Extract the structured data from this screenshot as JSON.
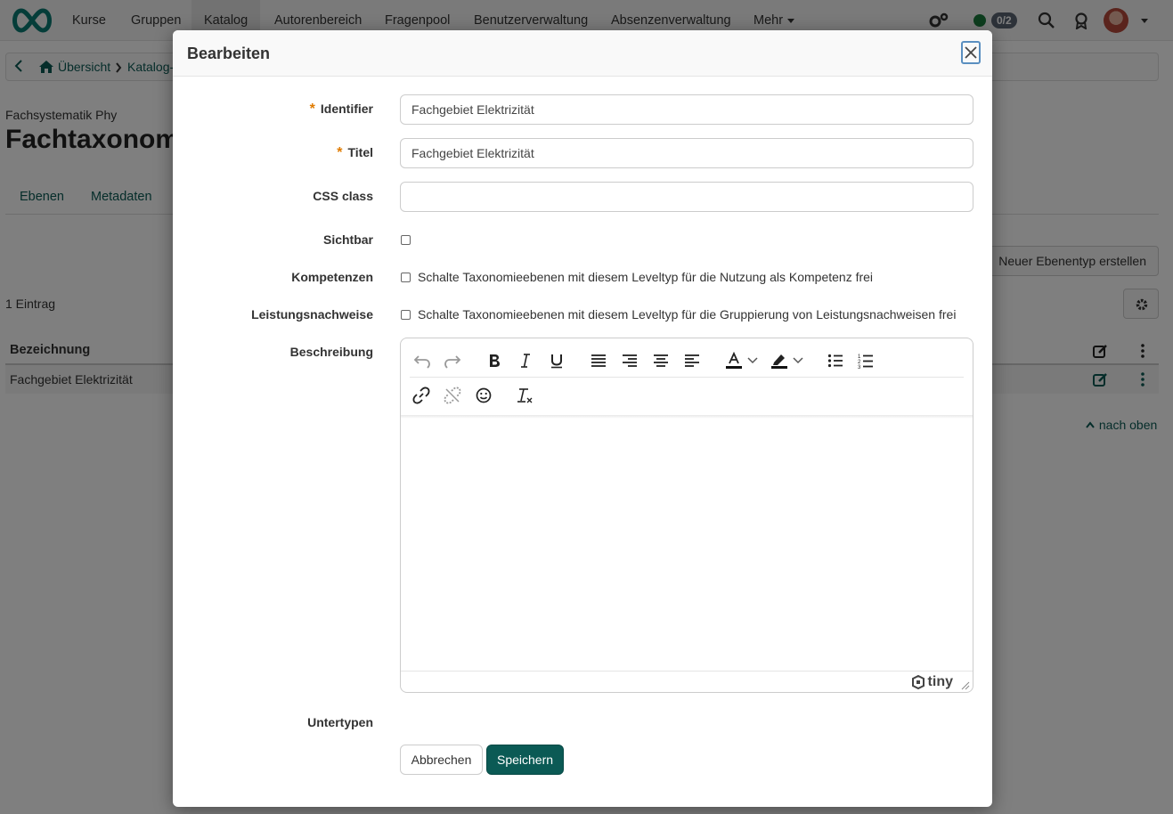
{
  "topnav": {
    "items": [
      "Kurse",
      "Gruppen",
      "Katalog",
      "Autorenbereich",
      "Fragenpool",
      "Benutzerverwaltung",
      "Absenzenverwaltung",
      "Mehr"
    ],
    "active": "Katalog",
    "badge": "0/2"
  },
  "breadcrumb": {
    "items": [
      "Übersicht",
      "Katalog-"
    ]
  },
  "page": {
    "subtitle": "Fachsystematik Phy",
    "title": "Fachtaxonomi",
    "tabs": [
      "Ebenen",
      "Metadaten"
    ],
    "new_type_button": "Neuer Ebenentyp erstellen",
    "count": "1 Eintrag",
    "table_header": "Bezeichnung",
    "table_row": "Fachgebiet Elektrizität",
    "back_to_top": "nach oben"
  },
  "modal": {
    "title": "Bearbeiten",
    "identifier_label": "Identifier",
    "identifier_value": "Fachgebiet Elektrizität",
    "titel_label": "Titel",
    "titel_value": "Fachgebiet Elektrizität",
    "css_label": "CSS class",
    "css_value": "",
    "sichtbar_label": "Sichtbar",
    "kompetenzen_label": "Kompetenzen",
    "kompetenzen_text": "Schalte Taxonomieebenen mit diesem Leveltyp für die Nutzung als Kompetenz frei",
    "leistung_label": "Leistungsnachweise",
    "leistung_text": "Schalte Taxonomieebenen mit diesem Leveltyp für die Gruppierung von Leistungsnachweisen frei",
    "beschreibung_label": "Beschreibung",
    "untertypen_label": "Untertypen",
    "cancel_label": "Abbrechen",
    "save_label": "Speichern",
    "editor_brand": "tiny"
  },
  "colors": {
    "accent": "#0b5a55",
    "required": "#e07b00"
  }
}
